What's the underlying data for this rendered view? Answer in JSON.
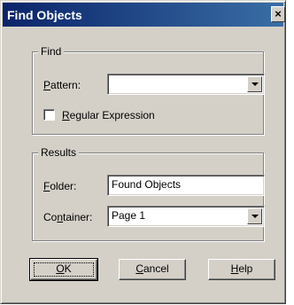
{
  "window": {
    "title": "Find Objects",
    "close_glyph": "×",
    "close_icon": "close-icon"
  },
  "find_group": {
    "title": "Find",
    "pattern_label_mnemonic": "P",
    "pattern_label_rest": "attern:",
    "pattern_value": "",
    "regex_checked": false,
    "regex_label_mnemonic": "R",
    "regex_label_rest": "egular Expression"
  },
  "results_group": {
    "title": "Results",
    "folder_label_mnemonic": "F",
    "folder_label_rest": "older:",
    "folder_value": "Found Objects",
    "container_label_pre": "Co",
    "container_label_mnemonic": "n",
    "container_label_rest": "tainer:",
    "container_value": "Page 1"
  },
  "buttons": {
    "ok_mnemonic": "O",
    "ok_rest": "K",
    "cancel_mnemonic": "C",
    "cancel_rest": "ancel",
    "help_mnemonic": "H",
    "help_rest": "elp"
  },
  "colors": {
    "face": "#d4d0c8",
    "title_start": "#0a246a",
    "title_end": "#3a6ea5"
  }
}
